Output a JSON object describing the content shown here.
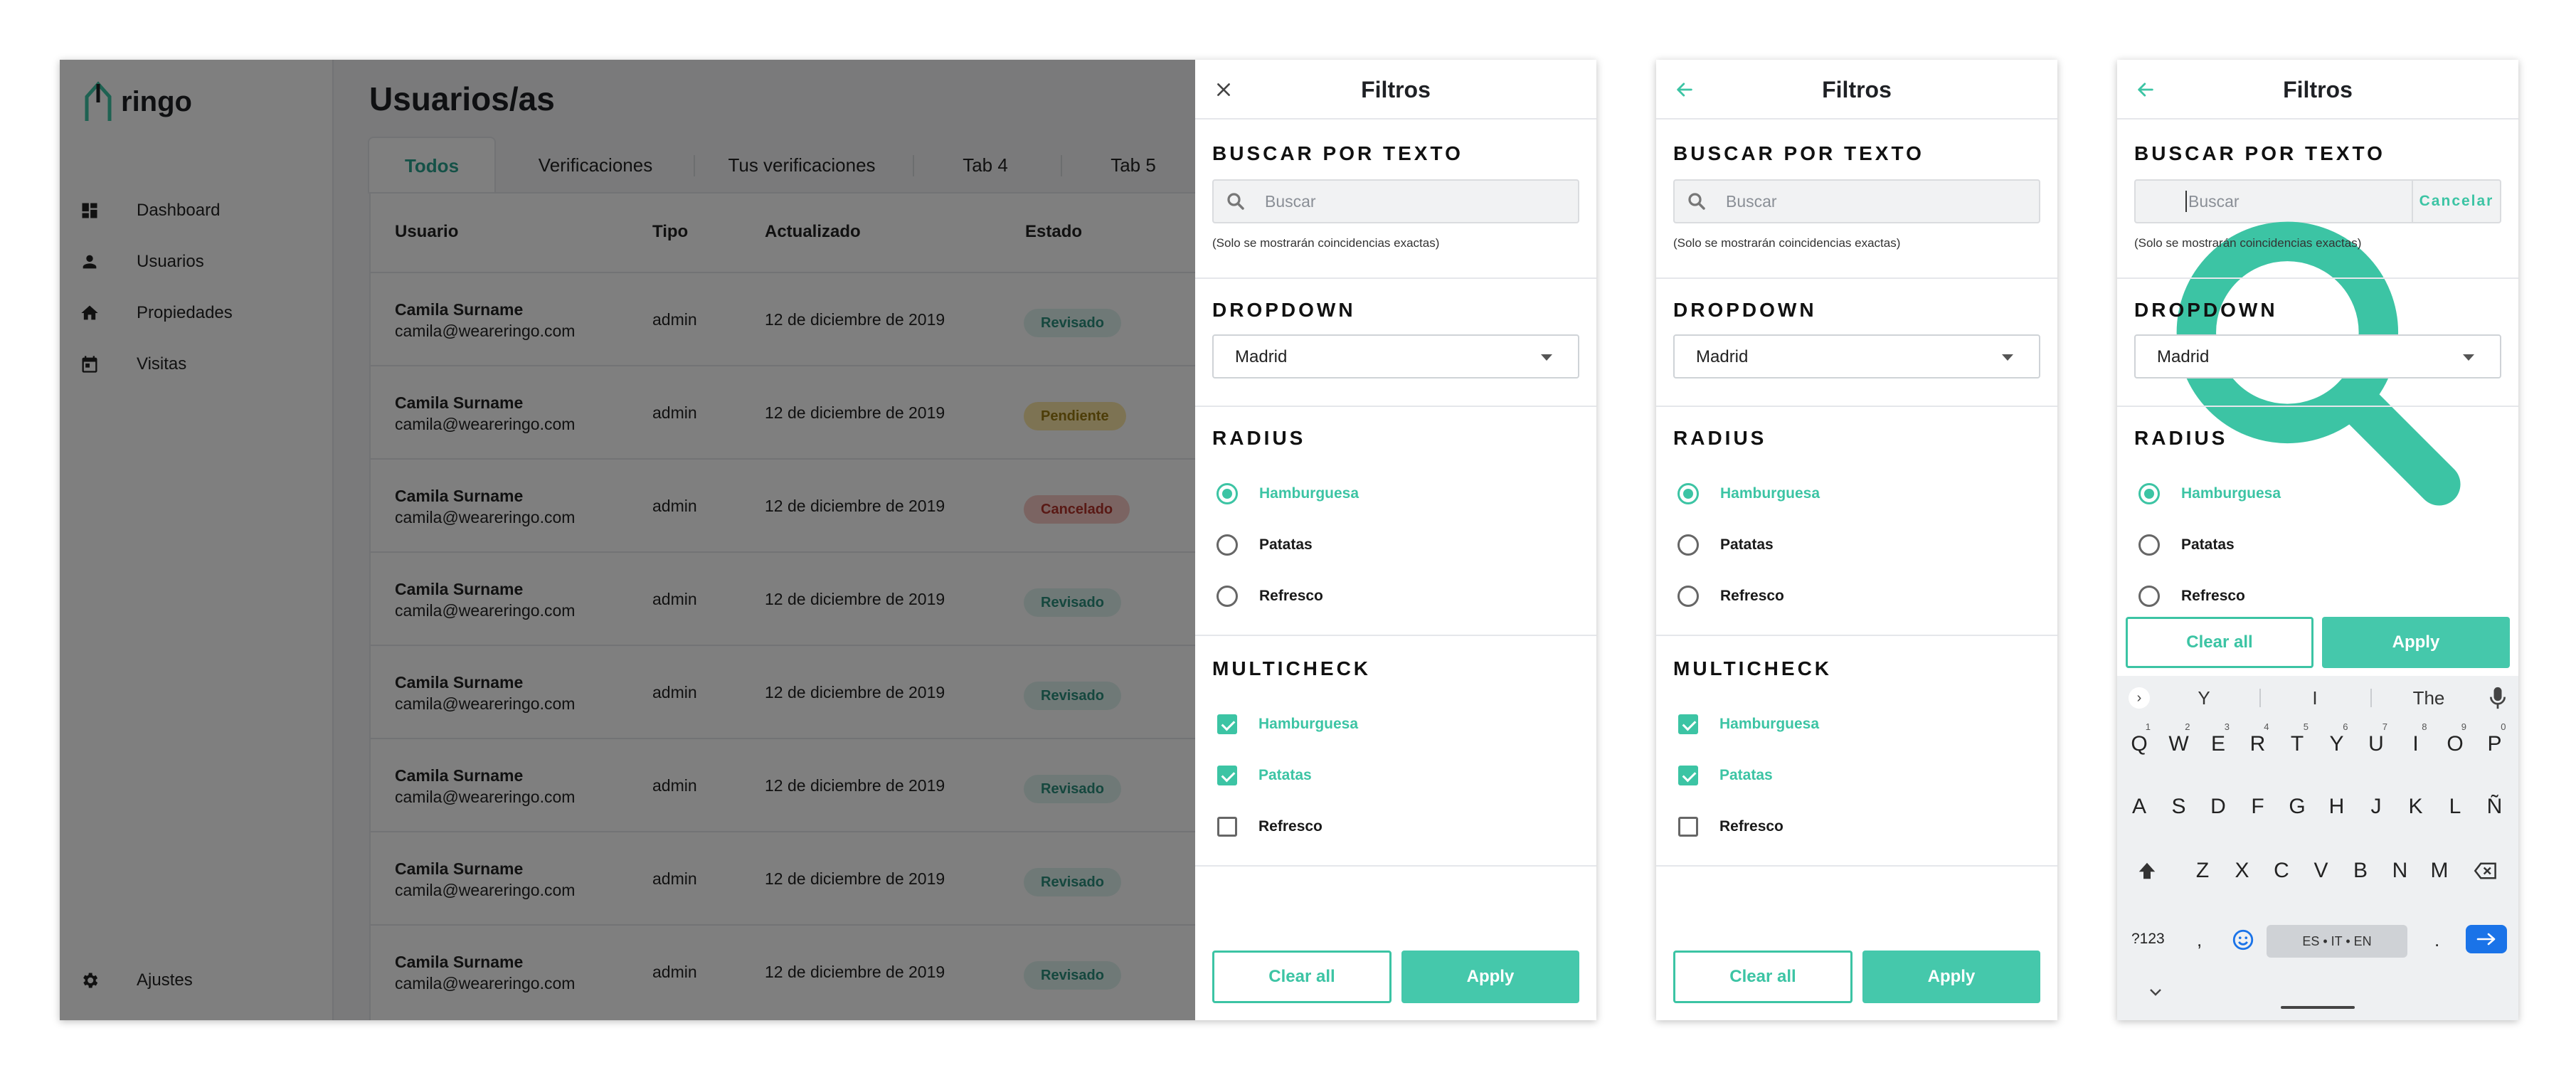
{
  "desktop": {
    "logo_text": "ringo",
    "nav": [
      {
        "label": "Dashboard",
        "icon": "dashboard-icon"
      },
      {
        "label": "Usuarios",
        "icon": "person-icon"
      },
      {
        "label": "Propiedades",
        "icon": "home-icon"
      },
      {
        "label": "Visitas",
        "icon": "calendar-icon"
      }
    ],
    "settings_label": "Ajustes",
    "page_title": "Usuarios/as",
    "tabs": [
      "Todos",
      "Verificaciones",
      "Tus verificaciones",
      "Tab 4",
      "Tab 5"
    ],
    "columns": [
      "Usuario",
      "Tipo",
      "Actualizado",
      "Estado"
    ],
    "rows": [
      {
        "name": "Camila Surname",
        "email": "camila@weareringo.com",
        "type": "admin",
        "updated": "12 de diciembre de 2019",
        "status": "Revisado",
        "status_kind": "ok"
      },
      {
        "name": "Camila Surname",
        "email": "camila@weareringo.com",
        "type": "admin",
        "updated": "12 de diciembre de 2019",
        "status": "Pendiente",
        "status_kind": "pending"
      },
      {
        "name": "Camila Surname",
        "email": "camila@weareringo.com",
        "type": "admin",
        "updated": "12 de diciembre de 2019",
        "status": "Cancelado",
        "status_kind": "cancel"
      },
      {
        "name": "Camila Surname",
        "email": "camila@weareringo.com",
        "type": "admin",
        "updated": "12 de diciembre de 2019",
        "status": "Revisado",
        "status_kind": "ok"
      },
      {
        "name": "Camila Surname",
        "email": "camila@weareringo.com",
        "type": "admin",
        "updated": "12 de diciembre de 2019",
        "status": "Revisado",
        "status_kind": "ok"
      },
      {
        "name": "Camila Surname",
        "email": "camila@weareringo.com",
        "type": "admin",
        "updated": "12 de diciembre de 2019",
        "status": "Revisado",
        "status_kind": "ok"
      },
      {
        "name": "Camila Surname",
        "email": "camila@weareringo.com",
        "type": "admin",
        "updated": "12 de diciembre de 2019",
        "status": "Revisado",
        "status_kind": "ok"
      },
      {
        "name": "Camila Surname",
        "email": "camila@weareringo.com",
        "type": "admin",
        "updated": "12 de diciembre de 2019",
        "status": "Revisado",
        "status_kind": "ok"
      }
    ]
  },
  "filters": {
    "title": "Filtros",
    "search_heading": "BUSCAR POR TEXTO",
    "search_placeholder": "Buscar",
    "search_hint": "(Solo se mostrarán coincidencias exactas)",
    "cancel_label": "Cancelar",
    "dropdown_heading": "DROPDOWN",
    "dropdown_value": "Madrid",
    "radius_heading": "RADIUS",
    "radius_options": [
      {
        "label": "Hamburguesa",
        "selected": true
      },
      {
        "label": "Patatas",
        "selected": false
      },
      {
        "label": "Refresco",
        "selected": false
      }
    ],
    "multicheck_heading": "MULTICHECK",
    "multicheck_options": [
      {
        "label": "Hamburguesa",
        "checked": true
      },
      {
        "label": "Patatas",
        "checked": true
      },
      {
        "label": "Refresco",
        "checked": false
      }
    ],
    "clear_label": "Clear all",
    "apply_label": "Apply"
  },
  "keyboard": {
    "suggestions": [
      "Y",
      "I",
      "The"
    ],
    "row1": [
      "Q",
      "W",
      "E",
      "R",
      "T",
      "Y",
      "U",
      "I",
      "O",
      "P"
    ],
    "row1_hints": [
      "1",
      "2",
      "3",
      "4",
      "5",
      "6",
      "7",
      "8",
      "9",
      "0"
    ],
    "row2": [
      "A",
      "S",
      "D",
      "F",
      "G",
      "H",
      "J",
      "K",
      "L",
      "Ñ"
    ],
    "row3": [
      "Z",
      "X",
      "C",
      "V",
      "B",
      "N",
      "M"
    ],
    "numbers_key": "?123",
    "comma_key": ",",
    "period_key": ".",
    "space_label": "ES • IT • EN"
  },
  "colors": {
    "accent": "#3cc4a4",
    "overlay": "rgba(0,0,0,0.5)",
    "enter_key": "#1a73e8"
  }
}
